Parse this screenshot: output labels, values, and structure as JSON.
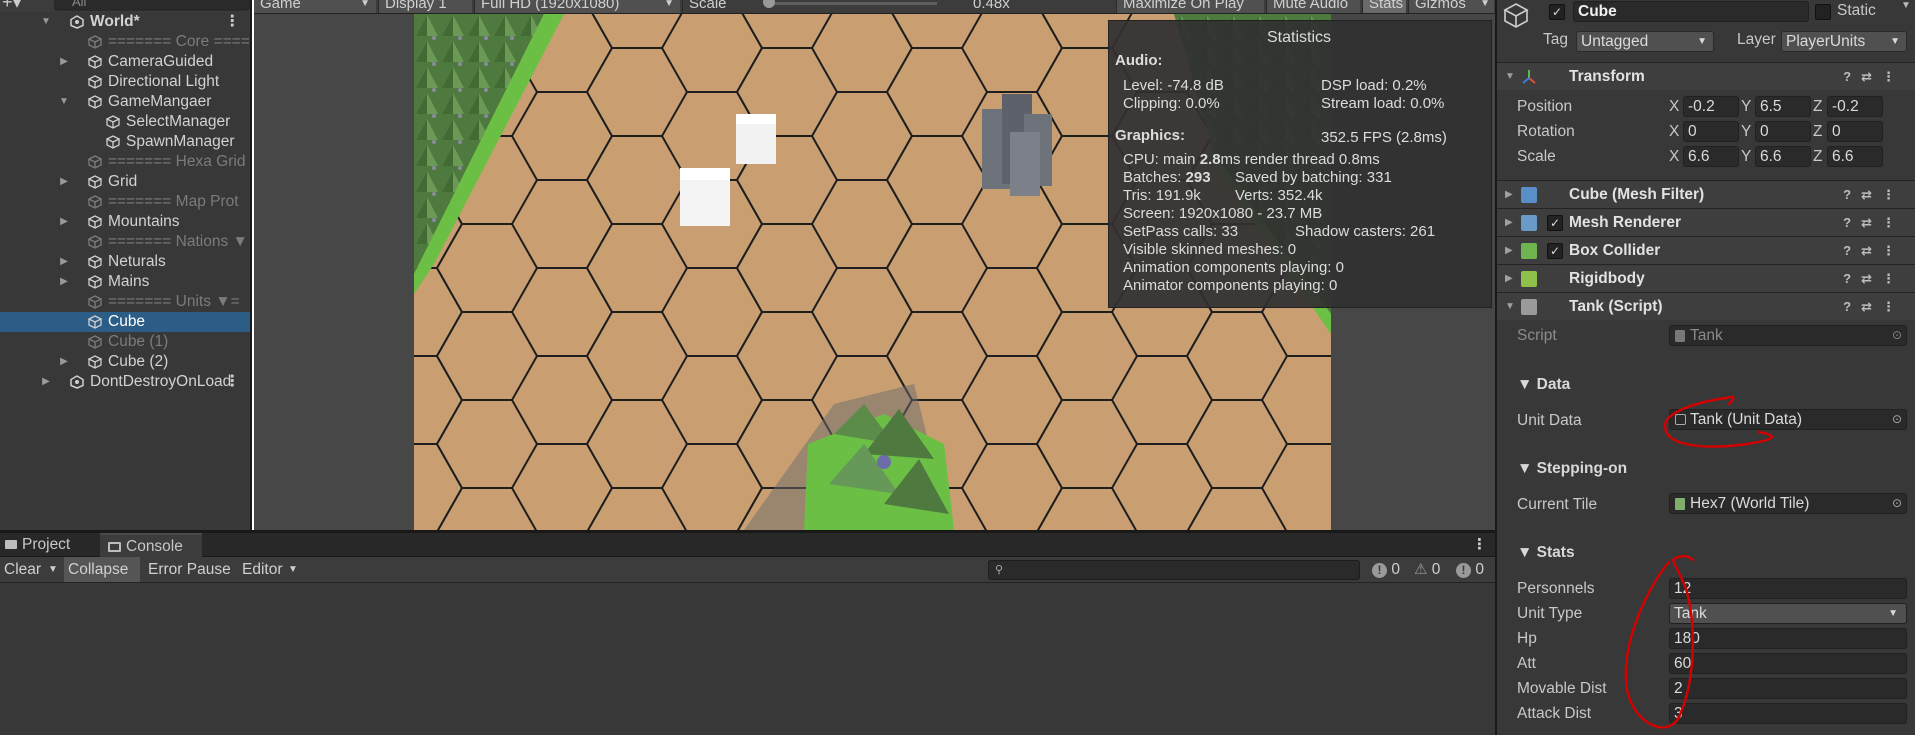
{
  "hierarchy": {
    "search_placeholder": "All",
    "rows": [
      {
        "label": "World*",
        "indent": 0,
        "arrow": "▼",
        "icon": "unity",
        "bold": true,
        "dim": false,
        "sel": false
      },
      {
        "label": "=======  Core  ======",
        "indent": 1,
        "arrow": "",
        "icon": "cube",
        "dim": true
      },
      {
        "label": "CameraGuided",
        "indent": 1,
        "arrow": "▶",
        "icon": "cube"
      },
      {
        "label": "Directional Light",
        "indent": 1,
        "arrow": "",
        "icon": "cube"
      },
      {
        "label": "GameMangaer",
        "indent": 1,
        "arrow": "▼",
        "icon": "cube"
      },
      {
        "label": "SelectManager",
        "indent": 2,
        "arrow": "",
        "icon": "cube"
      },
      {
        "label": "SpawnManager",
        "indent": 2,
        "arrow": "",
        "icon": "cube"
      },
      {
        "label": "=======  Hexa Grid",
        "indent": 1,
        "arrow": "",
        "icon": "cube",
        "dim": true
      },
      {
        "label": "Grid",
        "indent": 1,
        "arrow": "▶",
        "icon": "cube"
      },
      {
        "label": "=======  Map Prot",
        "indent": 1,
        "arrow": "",
        "icon": "cube",
        "dim": true
      },
      {
        "label": "Mountains",
        "indent": 1,
        "arrow": "▶",
        "icon": "cube"
      },
      {
        "label": "=======  Nations ▼",
        "indent": 1,
        "arrow": "",
        "icon": "cube",
        "dim": true
      },
      {
        "label": "Neturals",
        "indent": 1,
        "arrow": "▶",
        "icon": "cube"
      },
      {
        "label": "Mains",
        "indent": 1,
        "arrow": "▶",
        "icon": "cube"
      },
      {
        "label": "=======  Units  ▼=",
        "indent": 1,
        "arrow": "",
        "icon": "cube",
        "dim": true
      },
      {
        "label": "Cube",
        "indent": 1,
        "arrow": "",
        "icon": "cube",
        "sel": true
      },
      {
        "label": "Cube (1)",
        "indent": 1,
        "arrow": "",
        "icon": "cube",
        "dim": true
      },
      {
        "label": "Cube (2)",
        "indent": 1,
        "arrow": "▶",
        "icon": "cube"
      },
      {
        "label": "DontDestroyOnLoad",
        "indent": 0,
        "arrow": "▶",
        "icon": "unity"
      }
    ]
  },
  "game_toolbar": {
    "mode": "Game",
    "display": "Display 1",
    "resolution": "Full HD (1920x1080)",
    "scale_label": "Scale",
    "scale_value": "0.48x",
    "maximize": "Maximize On Play",
    "mute": "Mute Audio",
    "stats": "Stats",
    "gizmos": "Gizmos"
  },
  "statistics": {
    "title": "Statistics",
    "audio_heading": "Audio:",
    "level": "Level: -74.8 dB",
    "clipping": "Clipping: 0.0%",
    "dsp": "DSP load: 0.2%",
    "stream": "Stream load: 0.0%",
    "graphics_heading": "Graphics:",
    "fps": "352.5 FPS (2.8ms)",
    "cpu_prefix": "CPU: main ",
    "cpu_main": "2.8",
    "cpu_suffix": "ms  render thread 0.8ms",
    "batches_prefix": "Batches: ",
    "batches": "293",
    "saved": "Saved by batching: 331",
    "tris": "Tris: 191.9k",
    "verts": "Verts: 352.4k",
    "screen": "Screen: 1920x1080 - 23.7 MB",
    "setpass": "SetPass calls: 33",
    "shadow": "Shadow casters: 261",
    "skinned": "Visible skinned meshes: 0",
    "anim": "Animation components playing: 0",
    "animator": "Animator components playing: 0"
  },
  "bottom_tabs": {
    "project": "Project",
    "console": "Console"
  },
  "console_bar": {
    "clear": "Clear",
    "collapse": "Collapse",
    "error_pause": "Error Pause",
    "editor": "Editor",
    "count_info": "0",
    "count_warn": "0",
    "count_err": "0"
  },
  "inspector": {
    "object_name": "Cube",
    "static_label": "Static",
    "tag_label": "Tag",
    "tag_value": "Untagged",
    "layer_label": "Layer",
    "layer_value": "PlayerUnits",
    "transform": {
      "header": "Transform",
      "position_label": "Position",
      "rotation_label": "Rotation",
      "scale_label": "Scale",
      "position": [
        "-0.2",
        "6.5",
        "-0.2"
      ],
      "rotation": [
        "0",
        "0",
        "0"
      ],
      "scale": [
        "6.6",
        "6.6",
        "6.6"
      ],
      "axes": [
        "X",
        "Y",
        "Z"
      ]
    },
    "components": [
      "Cube (Mesh Filter)",
      "Mesh Renderer",
      "Box Collider",
      "Rigidbody",
      "Tank (Script)"
    ],
    "script_label": "Script",
    "script_value": "Tank",
    "data_section": "Data",
    "unit_data_label": "Unit Data",
    "unit_data_value": "Tank (Unit Data)",
    "stepping_section": "Stepping-on",
    "current_tile_label": "Current Tile",
    "current_tile_value": "Hex7 (World Tile)",
    "stats_section": "Stats",
    "stats_fields": [
      {
        "label": "Personnels",
        "value": "12"
      },
      {
        "label": "Unit Type",
        "value": "Tank"
      },
      {
        "label": "Hp",
        "value": "180"
      },
      {
        "label": "Att",
        "value": "60"
      },
      {
        "label": "Movable Dist",
        "value": "2"
      },
      {
        "label": "Attack Dist",
        "value": "3"
      }
    ]
  },
  "colors": {
    "selection": "#2c5d87",
    "tile": "#c89e72",
    "grass": "#6cbf45",
    "annotation": "#d60000"
  }
}
